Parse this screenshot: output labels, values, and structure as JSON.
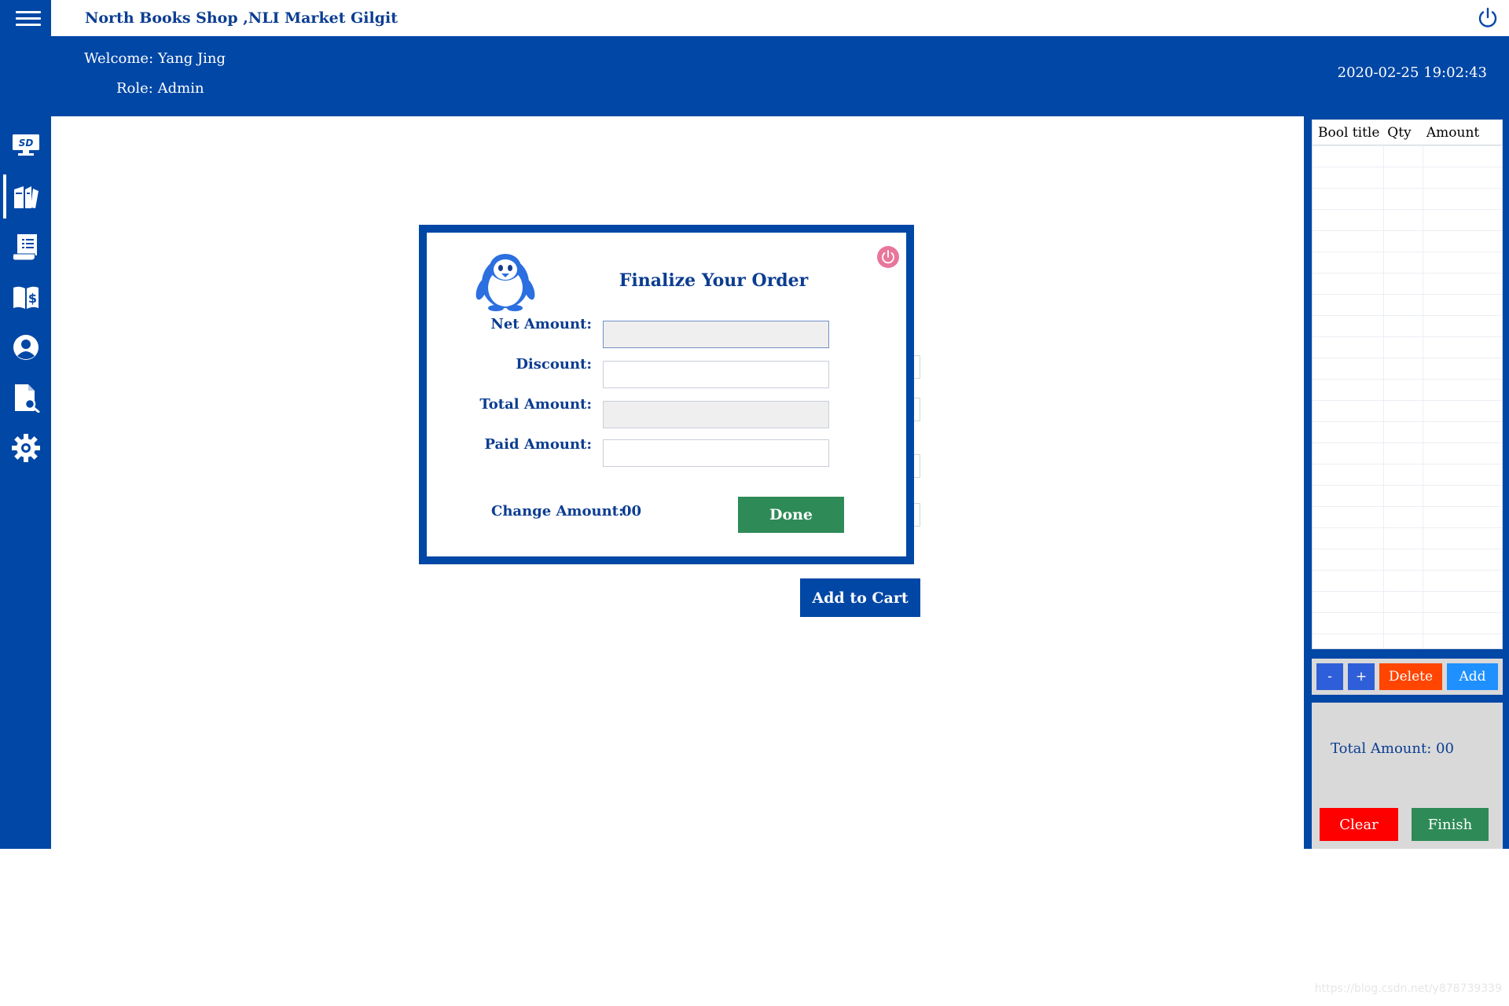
{
  "app": {
    "title": "North Books Shop ,NLI Market Gilgit",
    "menu_icon": "hamburger-icon",
    "power_icon": "power-icon"
  },
  "header": {
    "welcome_label": "Welcome:",
    "user_name": "Yang Jing",
    "role_label": "Role:",
    "role_value": "Admin",
    "datetime": "2020-02-25 19:02:43"
  },
  "sidebar": {
    "items": [
      {
        "name": "dashboard",
        "icon": "monitor-sd-icon",
        "active": false
      },
      {
        "name": "books",
        "icon": "books-icon",
        "active": true
      },
      {
        "name": "invoice",
        "icon": "document-list-icon",
        "active": false
      },
      {
        "name": "sales",
        "icon": "book-dollar-icon",
        "active": false
      },
      {
        "name": "users",
        "icon": "user-icon",
        "active": false
      },
      {
        "name": "search",
        "icon": "file-search-icon",
        "active": false
      },
      {
        "name": "settings",
        "icon": "gear-icon",
        "active": false
      }
    ]
  },
  "main": {
    "add_to_cart_label": "Add to Cart"
  },
  "modal": {
    "title": "Finalize Your Order",
    "logo_icon": "penguin-icon",
    "close_icon": "power-close-icon",
    "fields": {
      "net_amount": {
        "label": "Net Amount:",
        "value": ""
      },
      "discount": {
        "label": "Discount:",
        "value": ""
      },
      "total_amount": {
        "label": "Total Amount:",
        "value": ""
      },
      "paid_amount": {
        "label": "Paid Amount:",
        "value": ""
      }
    },
    "change_label": "Change Amount:",
    "change_value": "00",
    "done_label": "Done"
  },
  "cart": {
    "columns": [
      "Bool title",
      "Qty",
      "Amount"
    ],
    "rows": [],
    "actions": {
      "minus": "-",
      "plus": "+",
      "delete": "Delete",
      "add": "Add"
    },
    "total_label": "Total Amount:",
    "total_value": "00",
    "clear_label": "Clear",
    "finish_label": "Finish"
  },
  "colors": {
    "brand": "#0047a6",
    "done": "#2e8b57",
    "delete": "#ff4500",
    "clear": "#ff0000",
    "add": "#1e90ff",
    "step": "#2f5fd8"
  },
  "watermark": "https://blog.csdn.net/y878739339"
}
